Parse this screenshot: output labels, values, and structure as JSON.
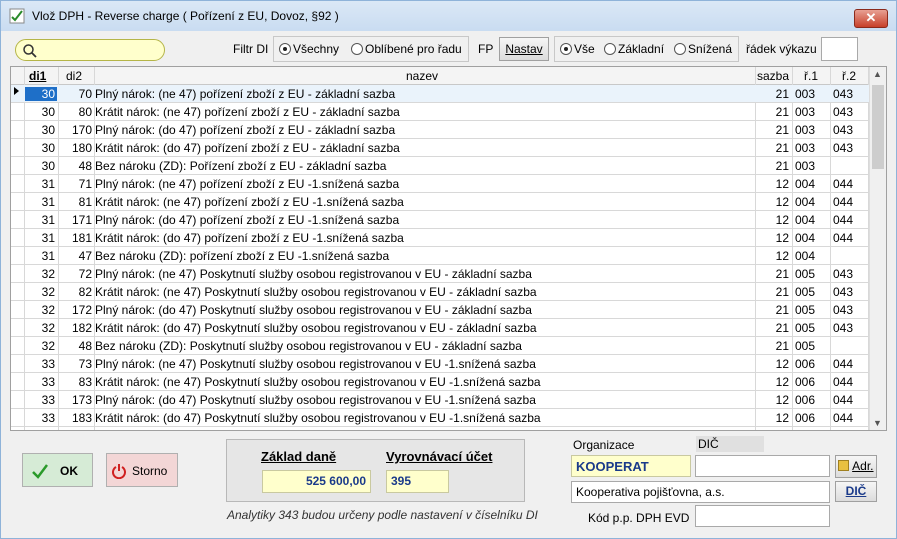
{
  "window": {
    "title": "Vlož DPH - Reverse charge ( Pořízení z EU, Dovoz, §92 )",
    "close_glyph": "✕"
  },
  "toolbar": {
    "search_placeholder": "",
    "filter_label": "Filtr DI",
    "filter_all": "Všechny",
    "filter_fav": "Oblíbené pro řadu",
    "fp_label": "FP",
    "setup_button": "Nastav",
    "rate_all": "Vše",
    "rate_base": "Základní",
    "rate_reduced": "Snížená",
    "line_label": "řádek výkazu",
    "line_value": ""
  },
  "grid": {
    "columns": [
      "di1",
      "di2",
      "nazev",
      "sazba",
      "ř.1",
      "ř.2"
    ],
    "rows": [
      {
        "di1": "30",
        "di2": "70",
        "nazev": "Plný nárok: (ne 47) pořízení zboží z EU - základní sazba",
        "sazba": "21",
        "r1": "003",
        "r2": "043"
      },
      {
        "di1": "30",
        "di2": "80",
        "nazev": "Krátit nárok: (ne 47) pořízení zboží z EU - základní sazba",
        "sazba": "21",
        "r1": "003",
        "r2": "043"
      },
      {
        "di1": "30",
        "di2": "170",
        "nazev": "Plný nárok: (do 47) pořízení zboží z EU - základní sazba",
        "sazba": "21",
        "r1": "003",
        "r2": "043"
      },
      {
        "di1": "30",
        "di2": "180",
        "nazev": "Krátit nárok: (do 47) pořízení zboží z EU - základní sazba",
        "sazba": "21",
        "r1": "003",
        "r2": "043"
      },
      {
        "di1": "30",
        "di2": "48",
        "nazev": "Bez nároku (ZD): Pořízení zboží z EU - základní sazba",
        "sazba": "21",
        "r1": "003",
        "r2": ""
      },
      {
        "di1": "31",
        "di2": "71",
        "nazev": "Plný nárok: (ne 47) pořízení zboží z EU -1.snížená sazba",
        "sazba": "12",
        "r1": "004",
        "r2": "044"
      },
      {
        "di1": "31",
        "di2": "81",
        "nazev": "Krátit nárok: (ne 47) pořízení zboží z EU -1.snížená sazba",
        "sazba": "12",
        "r1": "004",
        "r2": "044"
      },
      {
        "di1": "31",
        "di2": "171",
        "nazev": "Plný nárok: (do 47) pořízení zboží z EU -1.snížená sazba",
        "sazba": "12",
        "r1": "004",
        "r2": "044"
      },
      {
        "di1": "31",
        "di2": "181",
        "nazev": "Krátit nárok: (do 47) pořízení zboží z EU -1.snížená sazba",
        "sazba": "12",
        "r1": "004",
        "r2": "044"
      },
      {
        "di1": "31",
        "di2": "47",
        "nazev": "Bez nároku (ZD): pořízení zboží z EU -1.snížená sazba",
        "sazba": "12",
        "r1": "004",
        "r2": ""
      },
      {
        "di1": "32",
        "di2": "72",
        "nazev": "Plný nárok: (ne 47) Poskytnutí služby osobou registrovanou v EU - základní sazba",
        "sazba": "21",
        "r1": "005",
        "r2": "043"
      },
      {
        "di1": "32",
        "di2": "82",
        "nazev": "Krátit nárok: (ne 47) Poskytnutí služby osobou registrovanou v EU - základní sazba",
        "sazba": "21",
        "r1": "005",
        "r2": "043"
      },
      {
        "di1": "32",
        "di2": "172",
        "nazev": "Plný nárok: (do 47) Poskytnutí služby osobou registrovanou v EU - základní sazba",
        "sazba": "21",
        "r1": "005",
        "r2": "043"
      },
      {
        "di1": "32",
        "di2": "182",
        "nazev": "Krátit nárok: (do 47) Poskytnutí služby osobou registrovanou v EU - základní sazba",
        "sazba": "21",
        "r1": "005",
        "r2": "043"
      },
      {
        "di1": "32",
        "di2": "48",
        "nazev": "Bez nároku (ZD): Poskytnutí služby osobou registrovanou v EU - základní sazba",
        "sazba": "21",
        "r1": "005",
        "r2": ""
      },
      {
        "di1": "33",
        "di2": "73",
        "nazev": "Plný nárok: (ne 47) Poskytnutí služby osobou registrovanou v EU -1.snížená sazba",
        "sazba": "12",
        "r1": "006",
        "r2": "044"
      },
      {
        "di1": "33",
        "di2": "83",
        "nazev": "Krátit nárok: (ne 47) Poskytnutí služby osobou registrovanou v EU -1.snížená sazba",
        "sazba": "12",
        "r1": "006",
        "r2": "044"
      },
      {
        "di1": "33",
        "di2": "173",
        "nazev": "Plný nárok: (do 47) Poskytnutí služby osobou registrovanou v EU -1.snížená sazba",
        "sazba": "12",
        "r1": "006",
        "r2": "044"
      },
      {
        "di1": "33",
        "di2": "183",
        "nazev": "Krátit nárok: (do 47) Poskytnutí služby osobou registrovanou v EU -1.snížená sazba",
        "sazba": "12",
        "r1": "006",
        "r2": "044"
      }
    ]
  },
  "footer": {
    "ok_label": "OK",
    "cancel_label": "Storno",
    "base_label": "Základ daně",
    "base_value": "525 600,00",
    "account_label": "Vyrovnávací účet",
    "account_value": "395",
    "note": "Analytiky 343 budou určeny podle nastavení v číselníku DI",
    "org_label": "Organizace",
    "dic_label": "DIČ",
    "org_code": "KOOPERAT",
    "org_dic": "",
    "org_name": "Kooperativa pojišťovna, a.s.",
    "addr_button": "Adr.",
    "dic_button": "DIČ",
    "evd_label": "Kód p.p. DPH EVD",
    "evd_value": ""
  },
  "colors": {
    "selection": "#1e6fc8",
    "value_bg": "#ffffcc",
    "value_text": "#1a3a8a",
    "cancel_bg": "#f3d6d6",
    "ok_bg": "#d6ebd6"
  }
}
